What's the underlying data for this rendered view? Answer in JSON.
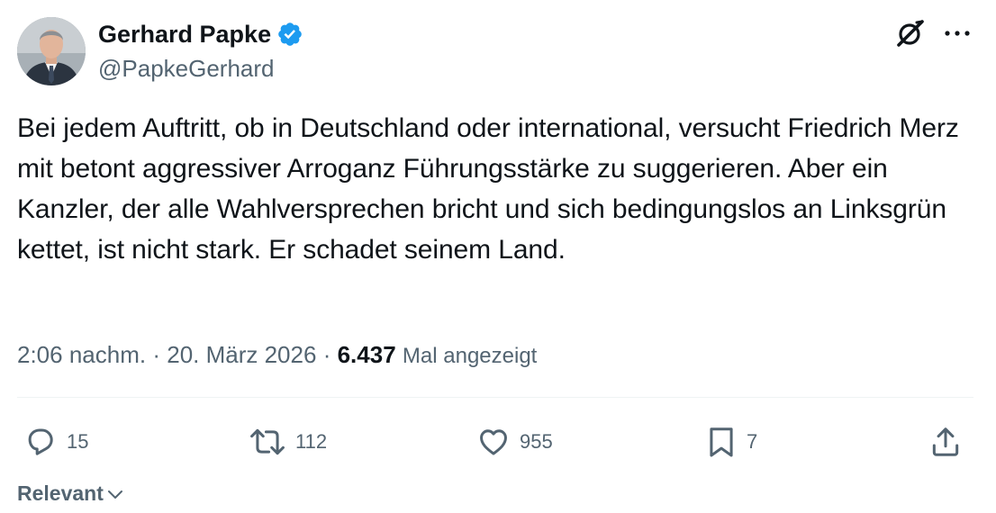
{
  "author": {
    "name": "Gerhard Papke",
    "handle": "@PapkeGerhard",
    "verified": true
  },
  "tweet": {
    "text": "Bei jedem Auftritt, ob in Deutschland oder international, versucht Friedrich Merz mit betont aggressiver Arroganz Führungsstärke zu suggerieren. Aber ein Kanzler, der alle Wahlversprechen bricht und sich bedingungslos an Linksgrün kettet, ist nicht stark. Er schadet seinem Land.",
    "time": "2:06 nachm.",
    "separator1": "·",
    "date": "20. März 2026",
    "separator2": "·",
    "views_count": "6.437",
    "views_label": "Mal angezeigt"
  },
  "actions": {
    "replies": "15",
    "reposts": "112",
    "likes": "955",
    "bookmarks": "7"
  },
  "sort": {
    "label": "Relevant"
  },
  "colors": {
    "text_primary": "#0f1419",
    "text_secondary": "#536471",
    "verified_blue": "#1d9bf0",
    "divider": "#eff3f4"
  },
  "icons": {
    "verified": "verified-badge-icon",
    "grok": "grok-icon",
    "more": "more-icon",
    "reply": "reply-icon",
    "repost": "repost-icon",
    "like": "like-icon",
    "bookmark": "bookmark-icon",
    "share": "share-icon",
    "chevron": "chevron-down-icon"
  }
}
